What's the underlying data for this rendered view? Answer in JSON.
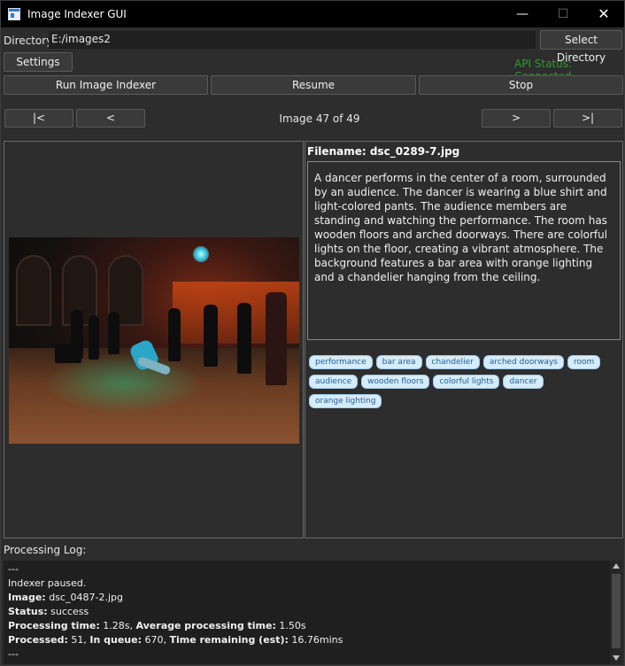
{
  "window": {
    "title": "Image Indexer GUI",
    "minimize": "—",
    "maximize": "☐",
    "close": "✕"
  },
  "directory": {
    "label": "Directory:",
    "value": "E:/images2",
    "select_button": "Select Directory"
  },
  "settings_button": "Settings",
  "api_status": {
    "text": "API Status: Connected",
    "color": "#2f9a2f"
  },
  "controls": {
    "run": "Run Image Indexer",
    "resume": "Resume",
    "stop": "Stop"
  },
  "navigation": {
    "first": "|<",
    "prev": "<",
    "counter": "Image 47 of 49",
    "next": ">",
    "last": ">|"
  },
  "details": {
    "filename_label": "Filename:",
    "filename": "dsc_0289-7.jpg",
    "description": "A dancer performs in the center of a room, surrounded by an audience. The dancer is wearing a blue shirt and light-colored pants. The audience members are standing and watching the performance. The room has wooden floors and arched doorways. There are colorful lights on the floor, creating a vibrant atmosphere. The background features a bar area with orange lighting and a chandelier hanging from the ceiling.",
    "tags": [
      "performance",
      "bar area",
      "chandelier",
      "arched doorways",
      "room",
      "audience",
      "wooden floors",
      "colorful lights",
      "dancer",
      "orange lighting"
    ]
  },
  "log": {
    "label": "Processing Log:",
    "separator_top": "---",
    "paused": "Indexer paused.",
    "image_label": "Image:",
    "image_value": "dsc_0487-2.jpg",
    "status_label": "Status:",
    "status_value": "success",
    "proc_time_label": "Processing time:",
    "proc_time_value": "1.28s",
    "avg_label": "Average processing time:",
    "avg_value": "1.50s",
    "processed_label": "Processed:",
    "processed_value": "51",
    "queue_label": "In queue:",
    "queue_value": "670",
    "remaining_label": "Time remaining (est):",
    "remaining_value": "16.76mins",
    "separator_bottom": "---"
  }
}
